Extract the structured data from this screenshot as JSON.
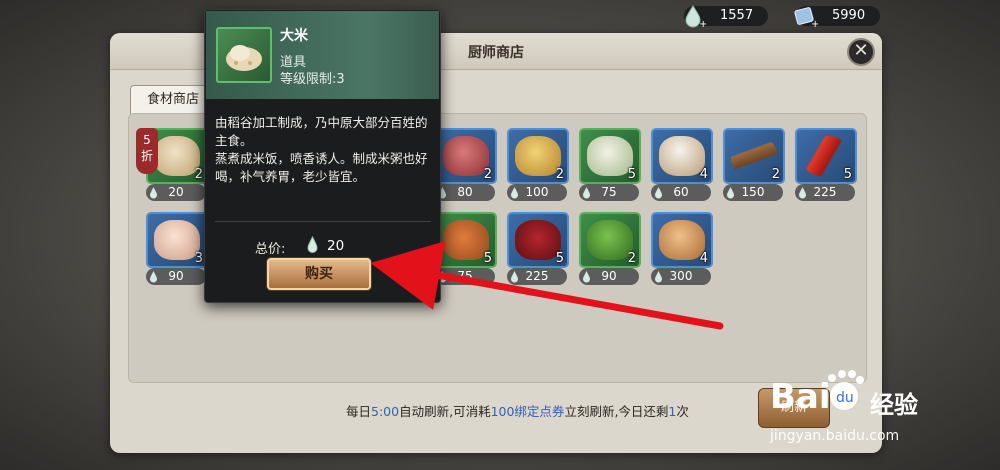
{
  "currency": [
    {
      "icon": "water-drop-icon",
      "value": "1557"
    },
    {
      "icon": "coupon-icon",
      "value": "5990"
    }
  ],
  "shop": {
    "title": "厨师商店",
    "tab": "食材商店"
  },
  "discount": {
    "value": "5",
    "unit": "折"
  },
  "items": [
    {
      "name": "大米",
      "count": "2",
      "price": "20",
      "rarity": "green",
      "art": "rice-sack"
    },
    {
      "name": "",
      "count": "2",
      "price": "80",
      "rarity": "blue",
      "art": "meat"
    },
    {
      "name": "",
      "count": "2",
      "price": "100",
      "rarity": "blue",
      "art": "potato"
    },
    {
      "name": "",
      "count": "5",
      "price": "75",
      "rarity": "green",
      "art": "garlic"
    },
    {
      "name": "",
      "count": "4",
      "price": "60",
      "rarity": "blue",
      "art": "flour-sack"
    },
    {
      "name": "",
      "count": "2",
      "price": "150",
      "rarity": "blue",
      "art": "cinnamon"
    },
    {
      "name": "",
      "count": "5",
      "price": "225",
      "rarity": "blue",
      "art": "chili"
    },
    {
      "name": "",
      "count": "3",
      "price": "90",
      "rarity": "blue",
      "art": "raw-chicken"
    },
    {
      "name": "",
      "count": "5",
      "price": "75",
      "rarity": "green",
      "art": "dish"
    },
    {
      "name": "",
      "count": "5",
      "price": "225",
      "rarity": "blue",
      "art": "wine-jar"
    },
    {
      "name": "",
      "count": "2",
      "price": "90",
      "rarity": "green",
      "art": "herbs"
    },
    {
      "name": "",
      "count": "4",
      "price": "300",
      "rarity": "blue",
      "art": "roast-chicken"
    }
  ],
  "tooltip": {
    "name": "大米",
    "type": "道具",
    "level": "等级限制:3",
    "desc": "由稻谷加工制成，乃中原大部分百姓的主食。\n蒸煮成米饭，喷香诱人。制成米粥也好喝，补气养胃，老少皆宜。",
    "total_label": "总价:",
    "total_value": "20",
    "buy_label": "购买"
  },
  "footer": {
    "p1": "每日",
    "time": "5:00",
    "p2": "自动刷新,可消耗",
    "cost": "100绑定点券",
    "p3": "立刻刷新,今日还剩",
    "left": "1",
    "p4": "次"
  },
  "refresh_label": "刷新",
  "watermark": {
    "text": "经验",
    "url": "jingyan.baidu.com"
  },
  "colors": {
    "accent": "#2e62b3",
    "blue_border": "#4f8fd6",
    "green_border": "#58b05c",
    "buy": "#c48a55"
  }
}
